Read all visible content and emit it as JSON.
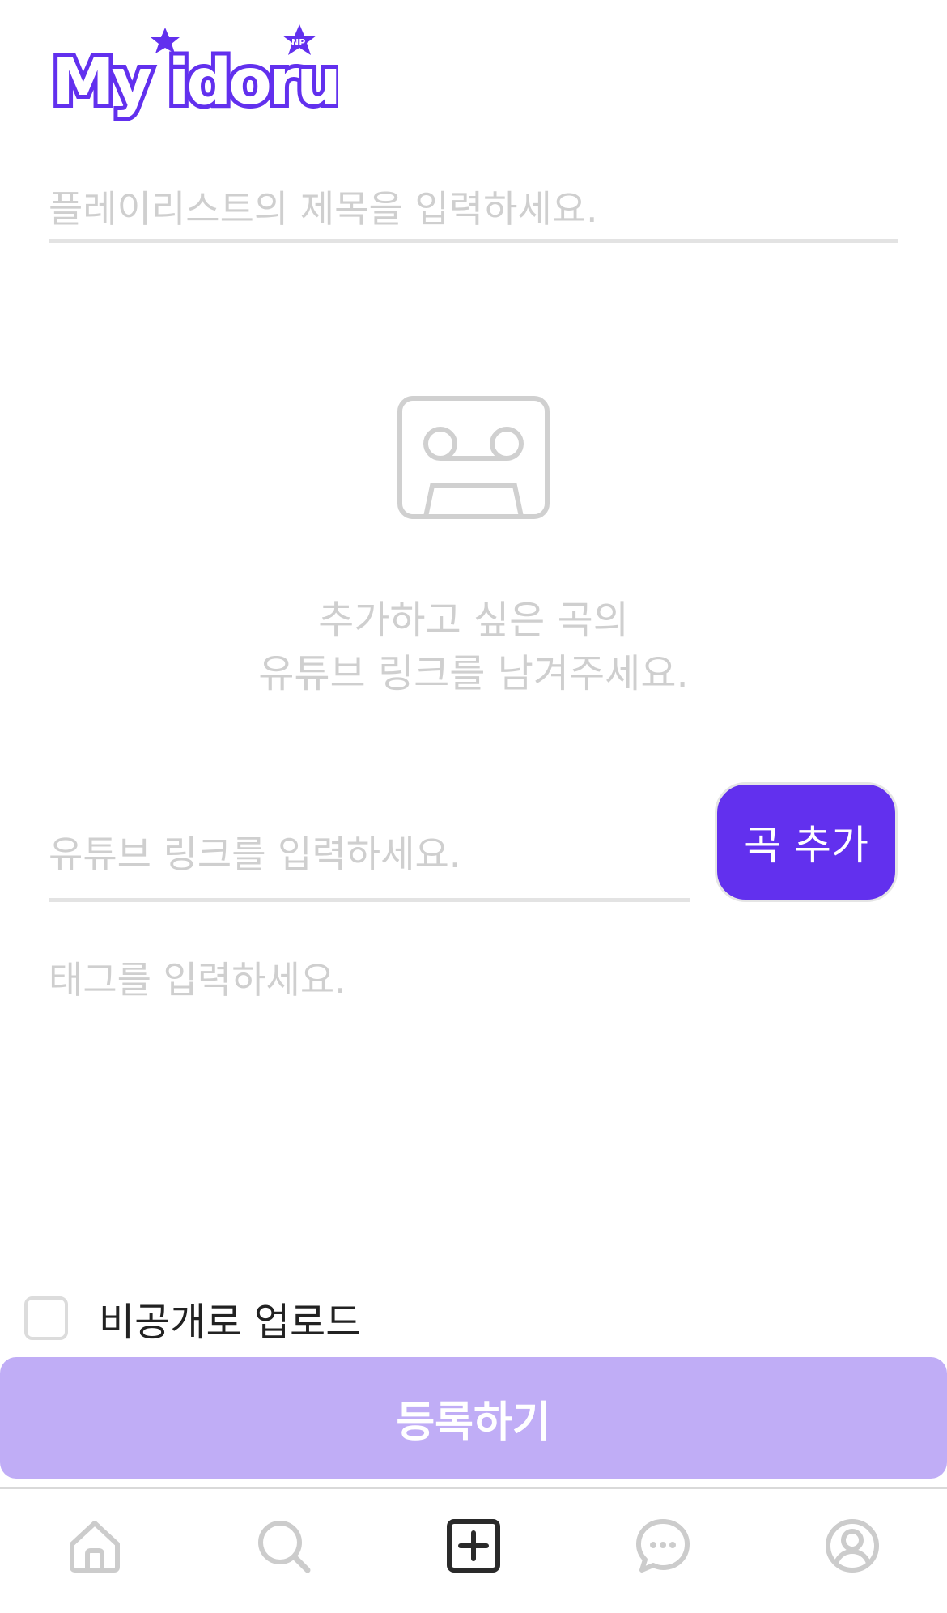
{
  "app": {
    "logo_text": "My idoru",
    "logo_badge": "NP"
  },
  "form": {
    "title_placeholder": "플레이리스트의 제목을 입력하세요.",
    "empty_line1": "추가하고 싶은 곡의",
    "empty_line2": "유튜브 링크를 남겨주세요.",
    "link_placeholder": "유튜브 링크를 입력하세요.",
    "add_button": "곡 추가",
    "tag_placeholder": "태그를 입력하세요.",
    "private_label": "비공개로 업로드",
    "private_checked": false,
    "submit_button": "등록하기"
  },
  "nav": {
    "items": [
      {
        "icon": "home-icon",
        "active": false
      },
      {
        "icon": "search-icon",
        "active": false
      },
      {
        "icon": "add-square-icon",
        "active": true
      },
      {
        "icon": "chat-bubble-icon",
        "active": false
      },
      {
        "icon": "profile-icon",
        "active": false
      }
    ]
  },
  "colors": {
    "brand": "#6230ee",
    "submit_disabled": "#c0adf6",
    "placeholder": "#cfcfcf",
    "icon_inactive": "#cccccc",
    "icon_active": "#2a2a2a"
  }
}
